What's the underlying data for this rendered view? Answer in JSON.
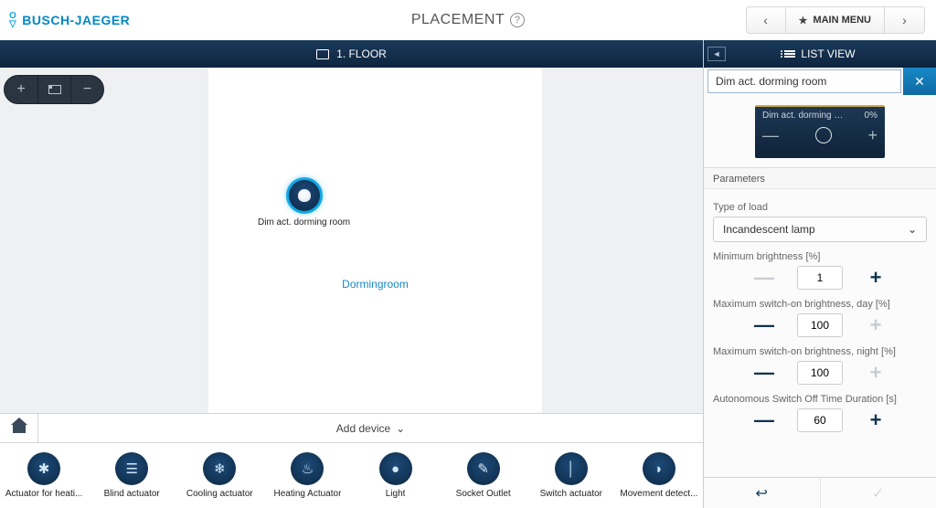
{
  "header": {
    "brand": "BUSCH-JAEGER",
    "title": "PLACEMENT",
    "main_menu": "MAIN MENU"
  },
  "floor_label": "1. FLOOR",
  "canvas": {
    "room_name": "Dormingroom",
    "device_label": "Dim act. dorming room"
  },
  "footer": {
    "add_device": "Add device"
  },
  "palette": [
    {
      "label": "Actuator for heati...",
      "glyph": "✱"
    },
    {
      "label": "Blind actuator",
      "glyph": "☰"
    },
    {
      "label": "Cooling actuator",
      "glyph": "❄"
    },
    {
      "label": "Heating Actuator",
      "glyph": "♨"
    },
    {
      "label": "Light",
      "glyph": "●"
    },
    {
      "label": "Socket Outlet",
      "glyph": "✎"
    },
    {
      "label": "Switch actuator",
      "glyph": "│"
    },
    {
      "label": "Movement detect...",
      "glyph": "◗"
    }
  ],
  "right": {
    "list_view": "LIST VIEW",
    "name_value": "Dim act. dorming room",
    "tile_name": "Dim act. dorming …",
    "tile_pct": "0%",
    "parameters_h": "Parameters",
    "p_load_label": "Type of load",
    "p_load_value": "Incandescent lamp",
    "p_min_label": "Minimum brightness [%]",
    "p_min_value": "1",
    "p_maxday_label": "Maximum switch-on brightness, day [%]",
    "p_maxday_value": "100",
    "p_maxnight_label": "Maximum switch-on brightness, night [%]",
    "p_maxnight_value": "100",
    "p_auto_label": "Autonomous Switch Off Time Duration [s]",
    "p_auto_value": "60"
  }
}
